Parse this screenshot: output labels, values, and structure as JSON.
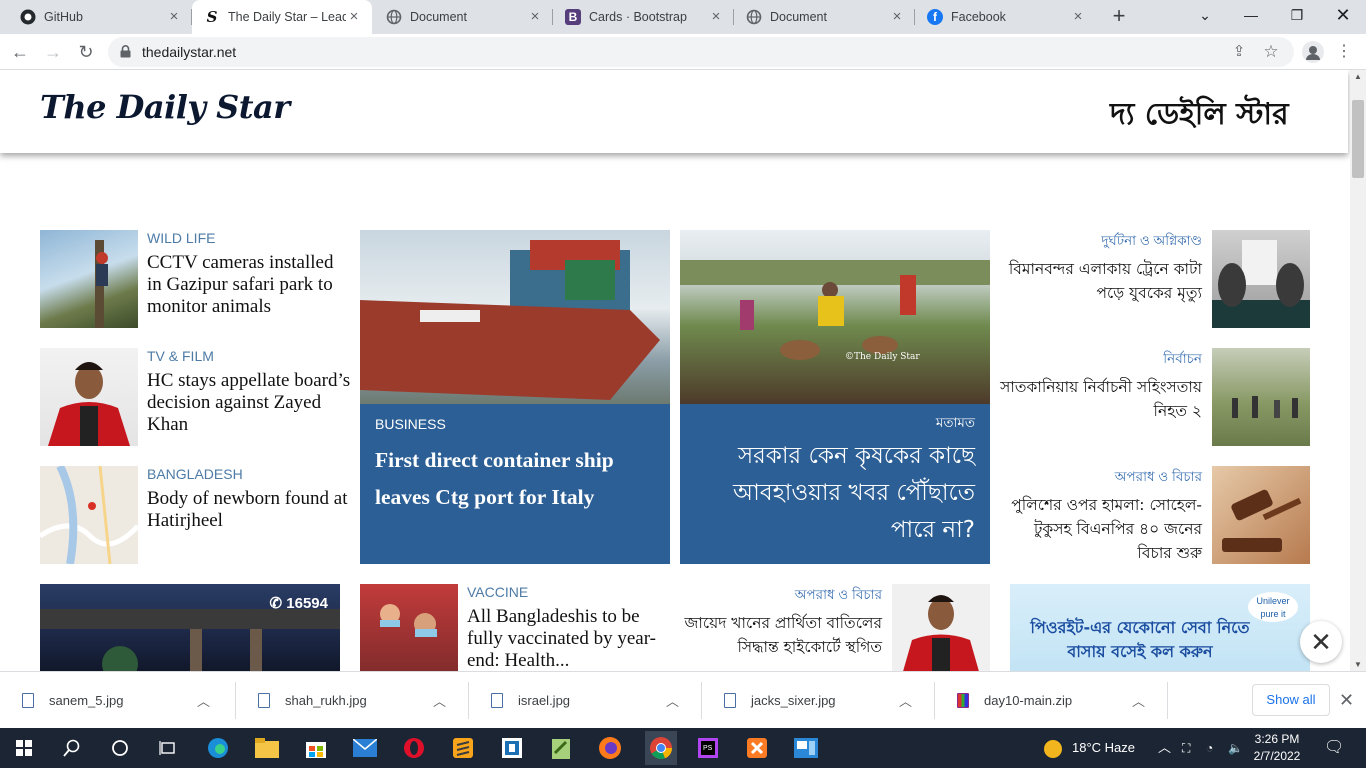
{
  "browser": {
    "tabs": [
      {
        "title": "GitHub",
        "icon": "github-icon",
        "active": false
      },
      {
        "title": "The Daily Star – Leadin",
        "icon": "dailystar-icon",
        "active": true
      },
      {
        "title": "Document",
        "icon": "globe-icon",
        "active": false
      },
      {
        "title": "Cards · Bootstrap",
        "icon": "bootstrap-icon",
        "active": false
      },
      {
        "title": "Document",
        "icon": "globe-icon",
        "active": false
      },
      {
        "title": "Facebook",
        "icon": "facebook-icon",
        "active": false
      }
    ],
    "url": "thedailystar.net"
  },
  "site": {
    "logo_en": "The Daily Star",
    "logo_bn": "দ্য ডেইলি স্টার",
    "left_stories": [
      {
        "category": "WILD LIFE",
        "headline": "CCTV cameras installed in Gazipur safari park to monitor animals"
      },
      {
        "category": "TV & FILM",
        "headline": "HC stays appellate board’s decision against Zayed Khan"
      },
      {
        "category": "BANGLADESH",
        "headline": "Body of newborn found at Hatirjheel"
      }
    ],
    "feature1": {
      "category": "BUSINESS",
      "headline": "First direct container ship leaves Ctg port for Italy"
    },
    "feature2": {
      "category": "মতামত",
      "headline": "সরকার কেন কৃষকের কাছে আবহাওয়ার খবর পৌঁছাতে পারে না?",
      "watermark": "©The Daily Star"
    },
    "right_stories": [
      {
        "category": "দুর্ঘটনা ও অগ্নিকাণ্ড",
        "headline": "বিমানবন্দর এলাকায় ট্রেনে কাটা পড়ে যুবকের মৃত্যু"
      },
      {
        "category": "নির্বাচন",
        "headline": "সাতকানিয়ায় নির্বাচনী সহিংসতায় নিহত ২"
      },
      {
        "category": "অপরাধ ও বিচার",
        "headline": "পুলিশের ওপর হামলা: সোহেল-টুকুসহ বিএনপির ৪০ জনের বিচার শুরু"
      }
    ],
    "ad1_hotline": "16594",
    "vaccine_story": {
      "category": "VACCINE",
      "headline": "All Bangladeshis to be fully vaccinated by year-end: Health..."
    },
    "bn_story4": {
      "category": "অপরাধ ও বিচার",
      "headline": "জায়েদ খানের প্রার্থিতা বাতিলের সিদ্ধান্ত হাইকোর্টে স্থগিত"
    },
    "ad2": {
      "brand": "Unilever pure it",
      "text": "পিওরইট-এর যেকোনো সেবা নিতে বাসায় বসেই কল করুন"
    }
  },
  "downloads": {
    "items": [
      "sanem_5.jpg",
      "shah_rukh.jpg",
      "israel.jpg",
      "jacks_sixer.jpg",
      "day10-main.zip"
    ],
    "show_all": "Show all"
  },
  "taskbar": {
    "weather": "18°C  Haze",
    "time": "3:26 PM",
    "date": "2/7/2022"
  },
  "colors": {
    "accent_blue": "#2c5f95",
    "category_blue": "#4d7ba6",
    "taskbar": "#1c2533"
  }
}
